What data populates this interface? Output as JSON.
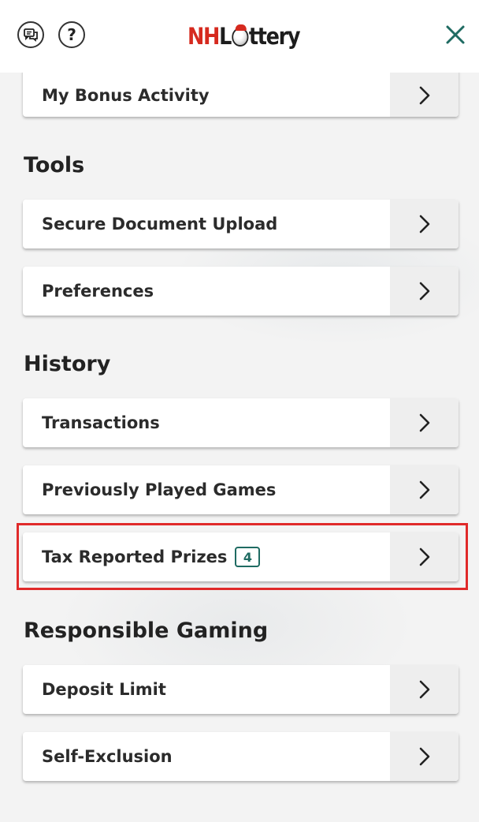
{
  "header": {
    "logo": {
      "prefix": "NH",
      "ball": "o",
      "suffix": "ttery",
      "text": "NHLottery"
    },
    "chat_icon": "chat-bubbles-icon",
    "help_label": "?",
    "close_icon": "close-icon"
  },
  "colors": {
    "accent": "#1f6b62",
    "brand_red": "#d62a1f",
    "highlight": "#e02a2a"
  },
  "sections": {
    "account": {
      "items": [
        {
          "label": "My Bonus Activity"
        }
      ]
    },
    "tools": {
      "title": "Tools",
      "items": [
        {
          "label": "Secure Document Upload"
        },
        {
          "label": "Preferences"
        }
      ]
    },
    "history": {
      "title": "History",
      "items": [
        {
          "label": "Transactions"
        },
        {
          "label": "Previously Played Games"
        },
        {
          "label": "Tax Reported Prizes",
          "badge": "4"
        }
      ]
    },
    "responsible": {
      "title": "Responsible Gaming",
      "items": [
        {
          "label": "Deposit Limit"
        },
        {
          "label": "Self-Exclusion"
        }
      ]
    }
  }
}
